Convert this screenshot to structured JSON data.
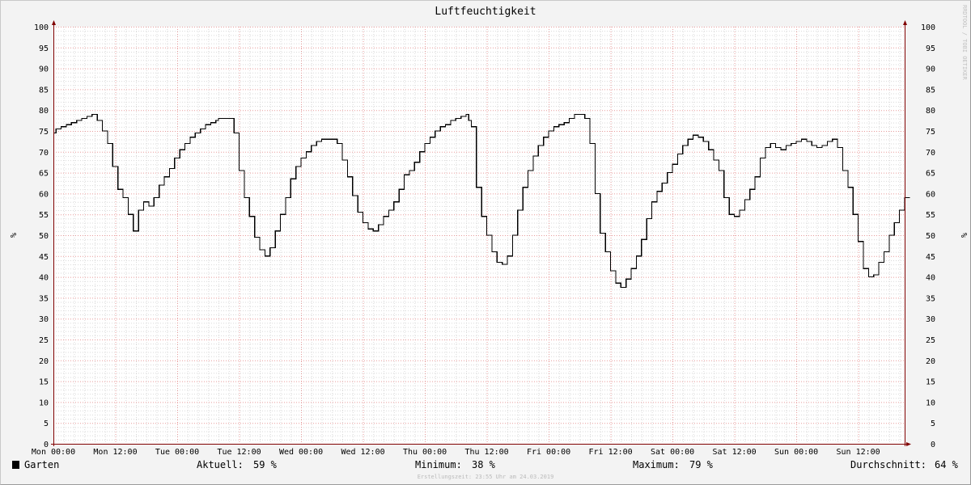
{
  "colors": {
    "background": "#f3f3f3",
    "canvas": "#ffffff",
    "grid_minor": "#d9d9d9",
    "grid_major": "#e79a9a",
    "axis": "#800000",
    "line": "#000000",
    "swatch": "#000000"
  },
  "chart_data": {
    "type": "line",
    "title": "Luftfeuchtigkeit",
    "ylabel": "%",
    "y2label": "%",
    "ylim": [
      0,
      100
    ],
    "yticks": [
      0,
      5,
      10,
      15,
      20,
      25,
      30,
      35,
      40,
      45,
      50,
      55,
      60,
      65,
      70,
      75,
      80,
      85,
      90,
      95,
      100
    ],
    "xlim": [
      "Mon 00:00",
      "Sun 21:00"
    ],
    "xticks": [
      "Mon 00:00",
      "Mon 12:00",
      "Tue 00:00",
      "Tue 12:00",
      "Wed 00:00",
      "Wed 12:00",
      "Thu 00:00",
      "Thu 12:00",
      "Fri 00:00",
      "Fri 12:00",
      "Sat 00:00",
      "Sat 12:00",
      "Sun 00:00",
      "Sun 12:00"
    ],
    "grid": true,
    "legend": "bottom",
    "series": [
      {
        "name": "Garten",
        "color": "#000000",
        "step": "post",
        "points": [
          [
            "Mon 00:00",
            74.5
          ],
          [
            "Mon 00:30",
            75.5
          ],
          [
            "Mon 01:30",
            76
          ],
          [
            "Mon 02:30",
            76.5
          ],
          [
            "Mon 03:30",
            77
          ],
          [
            "Mon 04:30",
            77.5
          ],
          [
            "Mon 05:30",
            78
          ],
          [
            "Mon 06:30",
            78.5
          ],
          [
            "Mon 07:30",
            79
          ],
          [
            "Mon 08:30",
            77.5
          ],
          [
            "Mon 09:30",
            75
          ],
          [
            "Mon 10:30",
            72
          ],
          [
            "Mon 11:30",
            66.5
          ],
          [
            "Mon 12:30",
            61
          ],
          [
            "Mon 13:30",
            59
          ],
          [
            "Mon 14:30",
            55
          ],
          [
            "Mon 15:30",
            51
          ],
          [
            "Mon 16:30",
            56
          ],
          [
            "Mon 17:30",
            58
          ],
          [
            "Mon 18:30",
            57
          ],
          [
            "Mon 19:30",
            59
          ],
          [
            "Mon 20:30",
            62
          ],
          [
            "Mon 21:30",
            64
          ],
          [
            "Mon 22:30",
            66
          ],
          [
            "Mon 23:30",
            68.5
          ],
          [
            "Tue 00:30",
            70.5
          ],
          [
            "Tue 01:30",
            72
          ],
          [
            "Tue 02:30",
            73.5
          ],
          [
            "Tue 03:30",
            74.5
          ],
          [
            "Tue 04:30",
            75.5
          ],
          [
            "Tue 05:30",
            76.5
          ],
          [
            "Tue 06:30",
            77
          ],
          [
            "Tue 07:30",
            77.5
          ],
          [
            "Tue 08:00",
            78
          ],
          [
            "Tue 11:00",
            74.5
          ],
          [
            "Tue 12:00",
            65.5
          ],
          [
            "Tue 13:00",
            59
          ],
          [
            "Tue 14:00",
            54.5
          ],
          [
            "Tue 15:00",
            49.5
          ],
          [
            "Tue 16:00",
            46.5
          ],
          [
            "Tue 17:00",
            45
          ],
          [
            "Tue 18:00",
            47
          ],
          [
            "Tue 19:00",
            51
          ],
          [
            "Tue 20:00",
            55
          ],
          [
            "Tue 21:00",
            59
          ],
          [
            "Tue 22:00",
            63.5
          ],
          [
            "Tue 23:00",
            66.5
          ],
          [
            "Wed 00:00",
            68.5
          ],
          [
            "Wed 01:00",
            70
          ],
          [
            "Wed 02:00",
            71.5
          ],
          [
            "Wed 03:00",
            72.5
          ],
          [
            "Wed 04:00",
            73
          ],
          [
            "Wed 07:00",
            72
          ],
          [
            "Wed 08:00",
            68
          ],
          [
            "Wed 09:00",
            64
          ],
          [
            "Wed 10:00",
            59.5
          ],
          [
            "Wed 11:00",
            55.5
          ],
          [
            "Wed 12:00",
            53
          ],
          [
            "Wed 13:00",
            51.5
          ],
          [
            "Wed 14:00",
            51
          ],
          [
            "Wed 15:00",
            52.5
          ],
          [
            "Wed 16:00",
            54.5
          ],
          [
            "Wed 17:00",
            56
          ],
          [
            "Wed 18:00",
            58
          ],
          [
            "Wed 19:00",
            61
          ],
          [
            "Wed 20:00",
            64.5
          ],
          [
            "Wed 21:00",
            65.5
          ],
          [
            "Wed 22:00",
            67.5
          ],
          [
            "Wed 23:00",
            70
          ],
          [
            "Thu 00:00",
            72
          ],
          [
            "Thu 01:00",
            73.5
          ],
          [
            "Thu 02:00",
            75
          ],
          [
            "Thu 03:00",
            76
          ],
          [
            "Thu 04:00",
            76.5
          ],
          [
            "Thu 05:00",
            77.5
          ],
          [
            "Thu 06:00",
            78
          ],
          [
            "Thu 07:00",
            78.5
          ],
          [
            "Thu 08:00",
            79
          ],
          [
            "Thu 08:30",
            77.5
          ],
          [
            "Thu 09:00",
            76
          ],
          [
            "Thu 10:00",
            61.5
          ],
          [
            "Thu 11:00",
            54.5
          ],
          [
            "Thu 12:00",
            50
          ],
          [
            "Thu 13:00",
            46
          ],
          [
            "Thu 14:00",
            43.5
          ],
          [
            "Thu 15:00",
            43
          ],
          [
            "Thu 16:00",
            45
          ],
          [
            "Thu 17:00",
            50
          ],
          [
            "Thu 18:00",
            56
          ],
          [
            "Thu 19:00",
            61.5
          ],
          [
            "Thu 20:00",
            65.5
          ],
          [
            "Thu 21:00",
            69
          ],
          [
            "Thu 22:00",
            71.5
          ],
          [
            "Thu 23:00",
            73.5
          ],
          [
            "Fri 00:00",
            75
          ],
          [
            "Fri 01:00",
            76
          ],
          [
            "Fri 02:00",
            76.5
          ],
          [
            "Fri 03:00",
            77
          ],
          [
            "Fri 04:00",
            78
          ],
          [
            "Fri 05:00",
            79
          ],
          [
            "Fri 07:00",
            78
          ],
          [
            "Fri 08:00",
            72
          ],
          [
            "Fri 09:00",
            60
          ],
          [
            "Fri 10:00",
            50.5
          ],
          [
            "Fri 11:00",
            46
          ],
          [
            "Fri 12:00",
            41.5
          ],
          [
            "Fri 13:00",
            38.5
          ],
          [
            "Fri 14:00",
            37.5
          ],
          [
            "Fri 15:00",
            39.5
          ],
          [
            "Fri 16:00",
            42
          ],
          [
            "Fri 17:00",
            45
          ],
          [
            "Fri 18:00",
            49
          ],
          [
            "Fri 19:00",
            54
          ],
          [
            "Fri 20:00",
            58
          ],
          [
            "Fri 21:00",
            60.5
          ],
          [
            "Fri 22:00",
            62.5
          ],
          [
            "Fri 23:00",
            65
          ],
          [
            "Sat 00:00",
            67
          ],
          [
            "Sat 01:00",
            69.5
          ],
          [
            "Sat 02:00",
            71.5
          ],
          [
            "Sat 03:00",
            73
          ],
          [
            "Sat 04:00",
            74
          ],
          [
            "Sat 05:00",
            73.5
          ],
          [
            "Sat 06:00",
            72.5
          ],
          [
            "Sat 07:00",
            70.5
          ],
          [
            "Sat 08:00",
            68
          ],
          [
            "Sat 09:00",
            65.5
          ],
          [
            "Sat 10:00",
            59
          ],
          [
            "Sat 11:00",
            55
          ],
          [
            "Sat 12:00",
            54.5
          ],
          [
            "Sat 13:00",
            56
          ],
          [
            "Sat 14:00",
            58.5
          ],
          [
            "Sat 15:00",
            61
          ],
          [
            "Sat 16:00",
            64
          ],
          [
            "Sat 17:00",
            68.5
          ],
          [
            "Sat 18:00",
            71
          ],
          [
            "Sat 19:00",
            72
          ],
          [
            "Sat 20:00",
            71
          ],
          [
            "Sat 21:00",
            70.5
          ],
          [
            "Sat 22:00",
            71.5
          ],
          [
            "Sat 23:00",
            72
          ],
          [
            "Sun 00:00",
            72.5
          ],
          [
            "Sun 01:00",
            73
          ],
          [
            "Sun 02:00",
            72.5
          ],
          [
            "Sun 03:00",
            71.5
          ],
          [
            "Sun 04:00",
            71
          ],
          [
            "Sun 05:00",
            71.5
          ],
          [
            "Sun 06:00",
            72.5
          ],
          [
            "Sun 07:00",
            73
          ],
          [
            "Sun 08:00",
            71
          ],
          [
            "Sun 09:00",
            65.5
          ],
          [
            "Sun 10:00",
            61.5
          ],
          [
            "Sun 11:00",
            55
          ],
          [
            "Sun 12:00",
            48.5
          ],
          [
            "Sun 13:00",
            42
          ],
          [
            "Sun 14:00",
            40
          ],
          [
            "Sun 15:00",
            40.5
          ],
          [
            "Sun 16:00",
            43.5
          ],
          [
            "Sun 17:00",
            46
          ],
          [
            "Sun 18:00",
            50
          ],
          [
            "Sun 19:00",
            53
          ],
          [
            "Sun 20:00",
            56
          ],
          [
            "Sun 21:00",
            59
          ],
          [
            "Sun 22:00",
            59
          ]
        ]
      }
    ]
  },
  "legend": {
    "series_name": "Garten",
    "aktuell_label": "Aktuell:",
    "aktuell_value": "59 %",
    "minimum_label": "Minimum:",
    "minimum_value": "38 %",
    "maximum_label": "Maximum:",
    "maximum_value": "79 %",
    "durchschnitt_label": "Durchschnitt:",
    "durchschnitt_value": "64 %"
  },
  "footer": {
    "creation_text": "Erstellungszeit: 23:55 Uhr am 24.03.2019"
  },
  "watermark": {
    "text": "RRDTOOL / TOBI OETIKER"
  }
}
